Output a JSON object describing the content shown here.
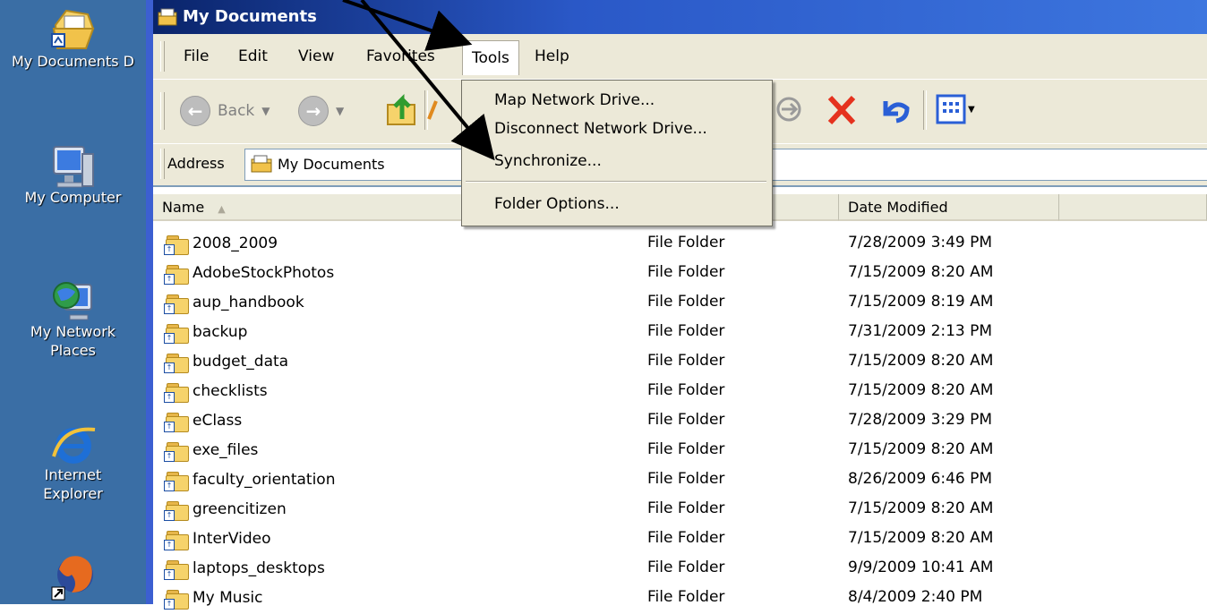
{
  "desktop": {
    "icons": [
      {
        "label": "My Documents D",
        "icon": "my-documents-icon"
      },
      {
        "label": "My Computer",
        "icon": "my-computer-icon"
      },
      {
        "label": "My Network Places",
        "label_line1": "My Network",
        "label_line2": "Places",
        "icon": "network-places-icon"
      },
      {
        "label": "Internet Explorer",
        "label_line1": "Internet",
        "label_line2": "Explorer",
        "icon": "internet-explorer-icon"
      },
      {
        "label": "",
        "icon": "firefox-icon"
      }
    ]
  },
  "window": {
    "title": "My Documents",
    "menu": [
      "File",
      "Edit",
      "View",
      "Favorites",
      "Tools",
      "Help"
    ],
    "active_menu": "Tools",
    "toolbar": {
      "back_label": "Back"
    },
    "address": {
      "label": "Address",
      "value": "My Documents"
    },
    "columns": {
      "name": "Name",
      "type": "",
      "date": "Date Modified",
      "extra": ""
    },
    "sort_indicator": "▲",
    "files": [
      {
        "name": "2008_2009",
        "type": "File Folder",
        "date": "7/28/2009 3:49 PM"
      },
      {
        "name": "AdobeStockPhotos",
        "type": "File Folder",
        "date": "7/15/2009 8:20 AM"
      },
      {
        "name": "aup_handbook",
        "type": "File Folder",
        "date": "7/15/2009 8:19 AM"
      },
      {
        "name": "backup",
        "type": "File Folder",
        "date": "7/31/2009 2:13 PM"
      },
      {
        "name": "budget_data",
        "type": "File Folder",
        "date": "7/15/2009 8:20 AM"
      },
      {
        "name": "checklists",
        "type": "File Folder",
        "date": "7/15/2009 8:20 AM"
      },
      {
        "name": "eClass",
        "type": "File Folder",
        "date": "7/28/2009 3:29 PM"
      },
      {
        "name": "exe_files",
        "type": "File Folder",
        "date": "7/15/2009 8:20 AM"
      },
      {
        "name": "faculty_orientation",
        "type": "File Folder",
        "date": "8/26/2009 6:46 PM"
      },
      {
        "name": "greencitizen",
        "type": "File Folder",
        "date": "7/15/2009 8:20 AM"
      },
      {
        "name": "InterVideo",
        "type": "File Folder",
        "date": "7/15/2009 8:20 AM"
      },
      {
        "name": "laptops_desktops",
        "type": "File Folder",
        "date": "9/9/2009 10:41 AM"
      },
      {
        "name": "My Music",
        "type": "File Folder",
        "date": "8/4/2009 2:40 PM"
      }
    ],
    "tools_menu": {
      "items": [
        "Map Network Drive...",
        "Disconnect Network Drive...",
        "Synchronize...",
        "Folder Options..."
      ]
    }
  }
}
